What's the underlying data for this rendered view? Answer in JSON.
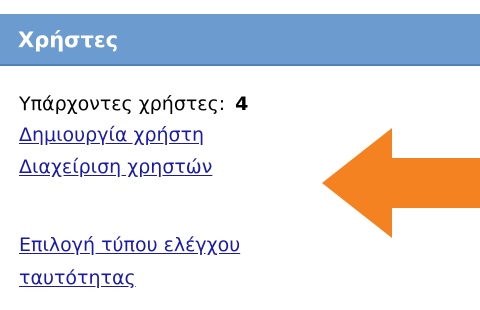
{
  "panel": {
    "title": "Χρήστες"
  },
  "users": {
    "existing_label": "Υπάρχοντες χρήστες:",
    "existing_count": "4",
    "links": {
      "create_user": "Δημιουργία χρήστη",
      "manage_users": "Διαχείριση χρηστών",
      "auth_type_line1": "Επιλογή τύπου ελέγχου",
      "auth_type_line2": "ταυτότητας"
    }
  },
  "colors": {
    "header_bg": "#6b9bcf",
    "link": "#1a1aa6",
    "arrow": "#f58220"
  },
  "icons": {
    "arrow": "left-arrow-icon"
  }
}
